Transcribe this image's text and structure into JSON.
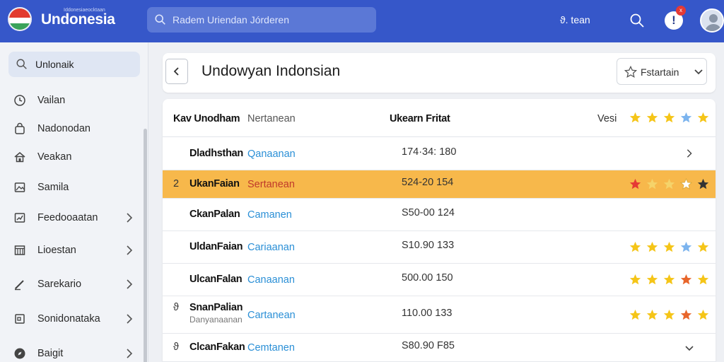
{
  "app": {
    "brand": "Undonesia",
    "brand_sub": "Iddonesiaeocktaan",
    "search_placeholder": "Radem Uriendan Jórderen",
    "user_label": "ϑ. tean",
    "notif_glyph": "!",
    "notif_badge": "x"
  },
  "sidebar": {
    "search_value": "Unlonaik",
    "items": [
      {
        "label": "Vailan",
        "icon": "clock-icon",
        "chevron": false
      },
      {
        "label": "Nadonodan",
        "icon": "bag-icon",
        "chevron": false
      },
      {
        "label": "Veakan",
        "icon": "home-icon",
        "chevron": false
      },
      {
        "label": "Samila",
        "icon": "image-icon",
        "chevron": false
      },
      {
        "label": "Feedooaatan",
        "icon": "chart-icon",
        "chevron": true
      },
      {
        "label": "Lioestan",
        "icon": "grid-icon",
        "chevron": true
      },
      {
        "label": "Sarekario",
        "icon": "pen-icon",
        "chevron": true
      },
      {
        "label": "Sonidonataka",
        "icon": "book-icon",
        "chevron": true
      },
      {
        "label": "Baigit",
        "icon": "compass-icon",
        "chevron": true
      }
    ]
  },
  "main": {
    "title": "Undowyan Indonsian",
    "filter_label": "Fstartain",
    "columns": {
      "name": "Kav Unodham",
      "category": "Nertanean",
      "value": "Ukearn Fritat",
      "rating": "Vesi"
    },
    "header_stars": [
      "#f5c518",
      "#f5c518",
      "#f5c518",
      "#7cb4ee",
      "#f5c518"
    ],
    "rows": [
      {
        "num": "",
        "name": "Dladhsthan",
        "sub": "",
        "category": "Qanaanan",
        "value": "174·34: 180",
        "highlight": false,
        "stars": [],
        "chevron": "right"
      },
      {
        "num": "2",
        "name": "UkanFaian",
        "sub": "",
        "category": "Sertanean",
        "value": "524-20 154",
        "highlight": true,
        "stars": [
          "#e53935",
          "#f5d36a",
          "#f5d36a",
          "#ffffff",
          "#333333"
        ],
        "chevron": ""
      },
      {
        "num": "",
        "name": "CkanPalan",
        "sub": "",
        "category": "Camanen",
        "value": "S50-00 124",
        "highlight": false,
        "stars": [],
        "chevron": ""
      },
      {
        "num": "",
        "name": "UldanFaian",
        "sub": "",
        "category": "Cariaanan",
        "value": "S10.90 133",
        "highlight": false,
        "stars": [
          "#f5c518",
          "#f5c518",
          "#f5c518",
          "#7cb4ee",
          "#f5c518"
        ],
        "chevron": ""
      },
      {
        "num": "",
        "name": "UlcanFalan",
        "sub": "",
        "category": "Canaanan",
        "value": "500.00 150",
        "highlight": false,
        "stars": [
          "#f5c518",
          "#f5c518",
          "#f5c518",
          "#e8662b",
          "#f5c518"
        ],
        "chevron": ""
      },
      {
        "num": "ϑ",
        "name": "SnanPalian",
        "sub": "Danyanaanan",
        "category": "Cartanean",
        "value": "110.00 133",
        "highlight": false,
        "stars": [
          "#f5c518",
          "#f5c518",
          "#f5c518",
          "#e8662b",
          "#f5c518"
        ],
        "chevron": ""
      },
      {
        "num": "ϑ",
        "name": "ClcanFakan",
        "sub": "",
        "category": "Cemtanen",
        "value": "S80.90 F85",
        "highlight": false,
        "stars": [],
        "chevron": "down"
      }
    ]
  }
}
